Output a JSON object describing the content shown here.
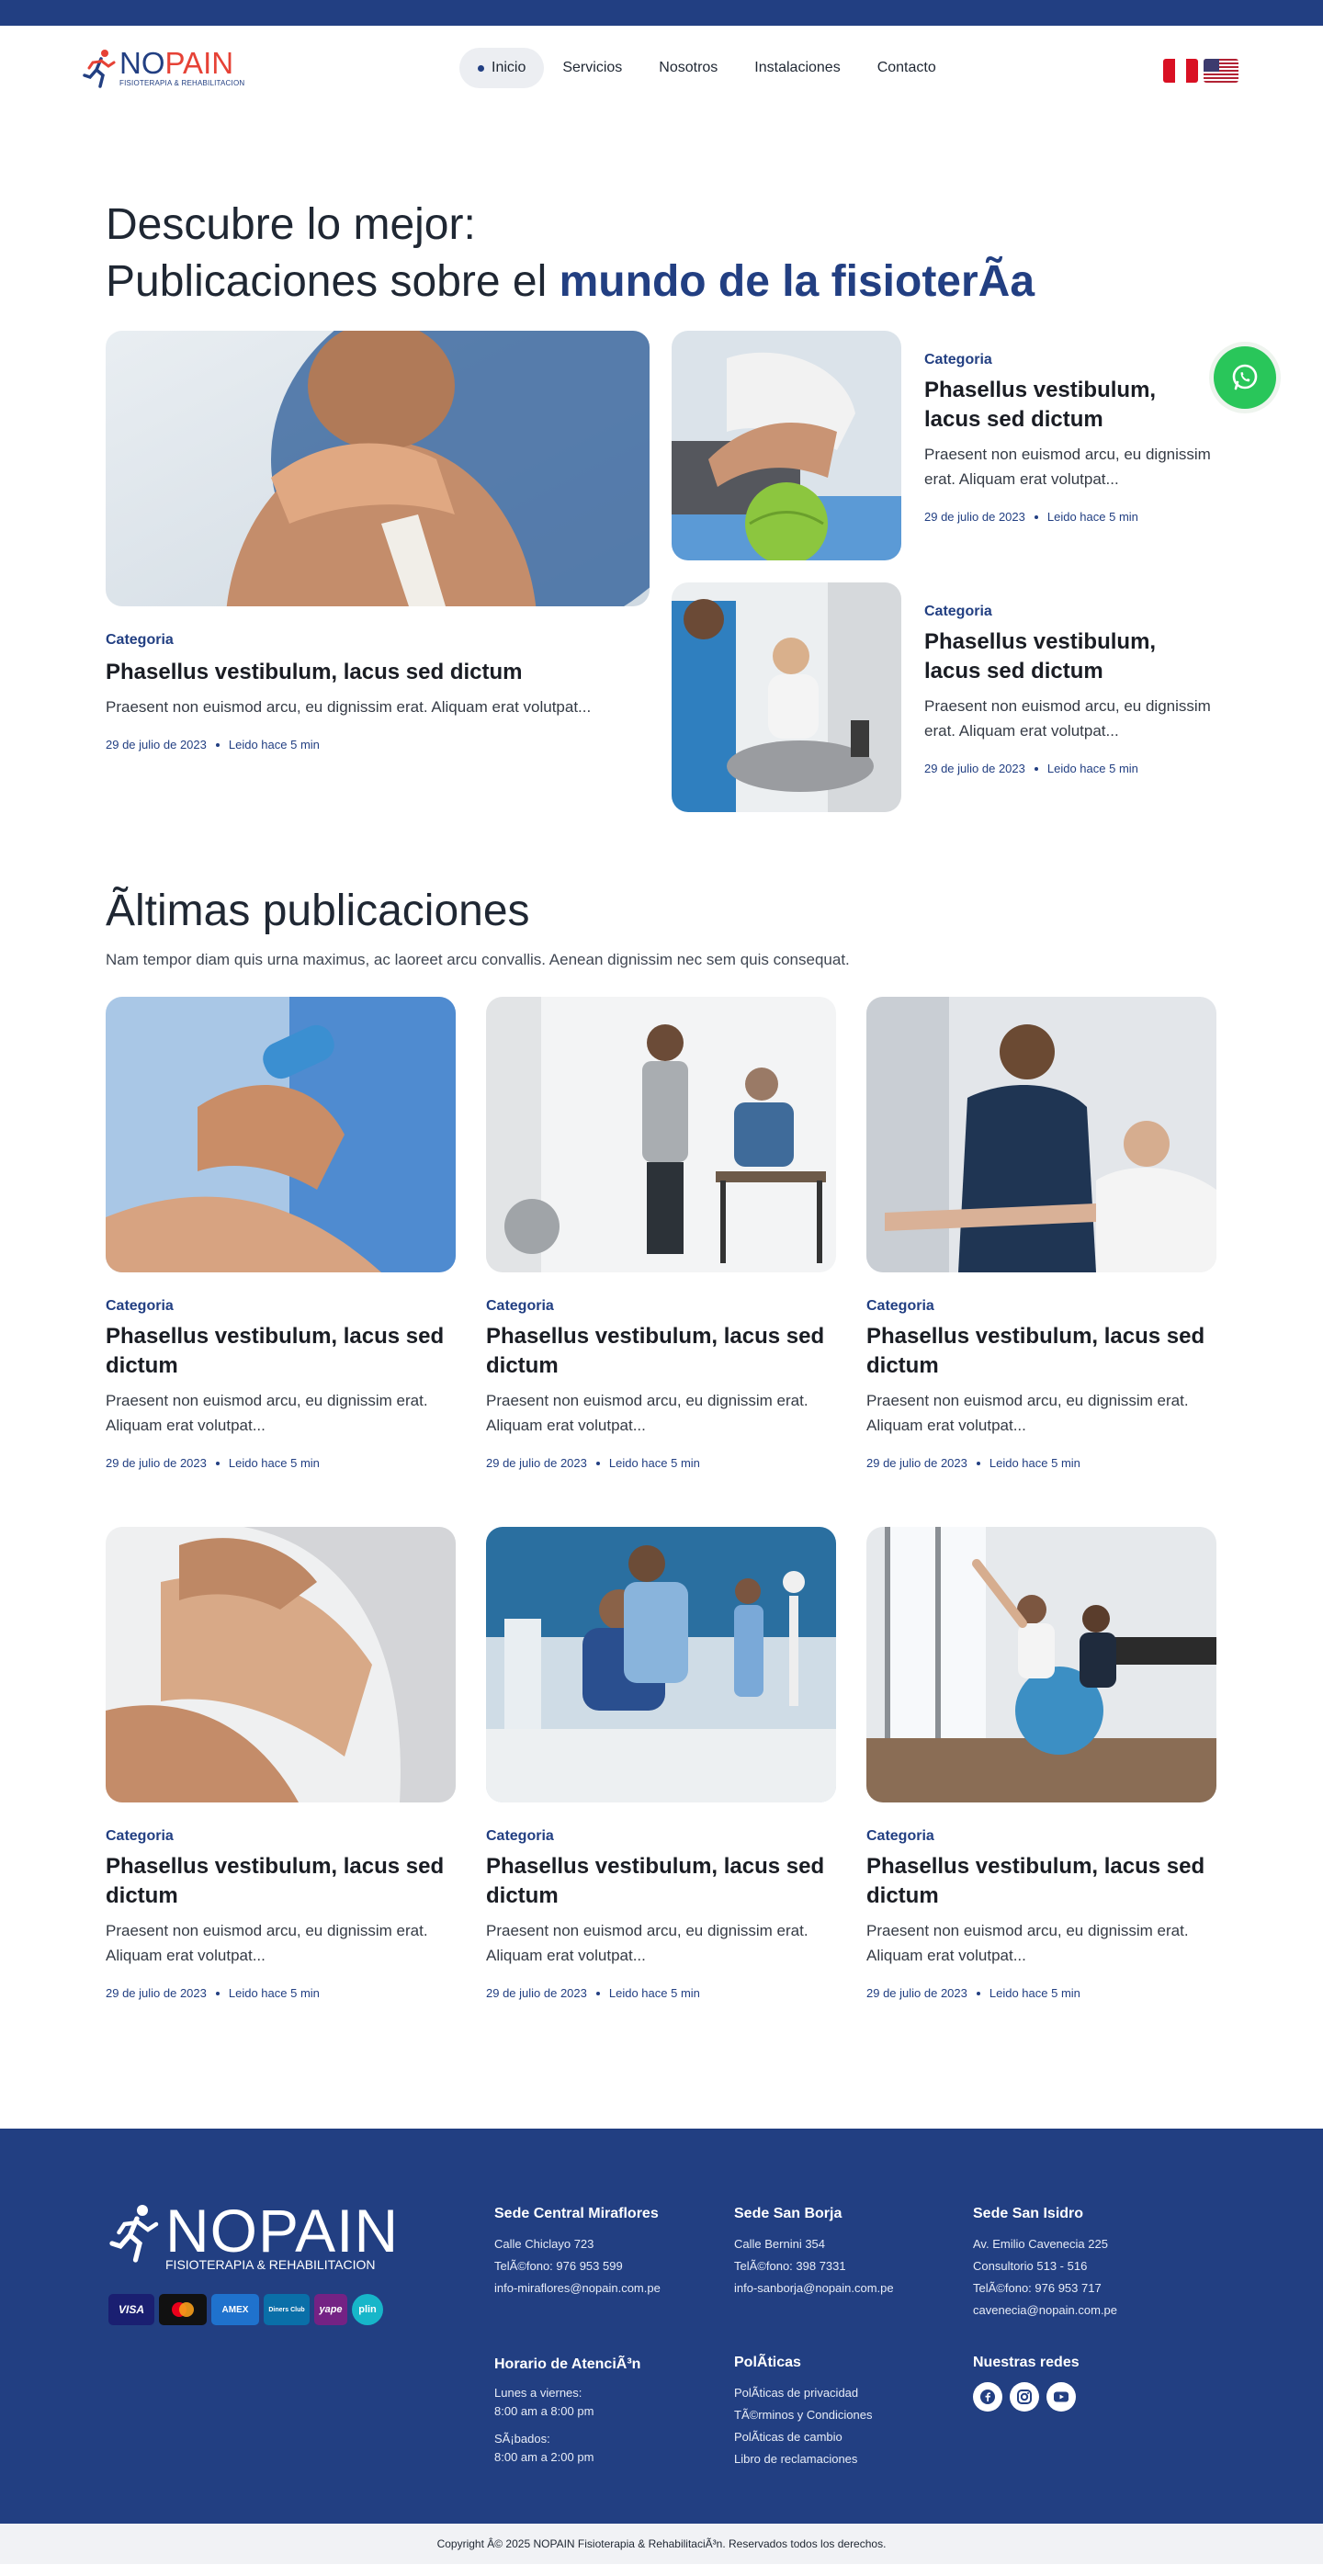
{
  "brand": {
    "name_part1": "NO",
    "name_part2": "PAIN",
    "tagline": "FISIOTERAPIA & REHABILITACION",
    "footer_name": "NOPAIN",
    "footer_tagline": "FISIOTERAPIA & REHABILITACION",
    "primary_color": "#223f82",
    "accent_color": "#e64236"
  },
  "nav": {
    "items": [
      {
        "label": "Inicio",
        "active": true
      },
      {
        "label": "Servicios"
      },
      {
        "label": "Nosotros"
      },
      {
        "label": "Instalaciones"
      },
      {
        "label": "Contacto"
      }
    ],
    "languages": [
      "peru-flag-icon",
      "usa-flag-icon"
    ]
  },
  "hero": {
    "line1": "Descubre lo mejor:",
    "line2_prefix": "Publicaciones sobre el ",
    "line2_accent": "mundo de la fisioterÃ­a"
  },
  "featured": {
    "main": {
      "category": "Categoria",
      "title": "Phasellus vestibulum, lacus sed dictum",
      "excerpt": "Praesent non euismod arcu, eu dignissim erat. Aliquam erat volutpat...",
      "date": "29 de julio de 2023",
      "read": "Leido hace 5 min"
    },
    "side": [
      {
        "category": "Categoria",
        "title": "Phasellus vestibulum, lacus sed dictum",
        "excerpt": "Praesent non euismod arcu, eu dignissim erat. Aliquam erat volutpat...",
        "date": "29 de julio de 2023",
        "read": "Leido hace 5 min"
      },
      {
        "category": "Categoria",
        "title": "Phasellus vestibulum, lacus sed dictum",
        "excerpt": "Praesent non euismod arcu, eu dignissim erat. Aliquam erat volutpat...",
        "date": "29 de julio de 2023",
        "read": "Leido hace 5 min"
      }
    ]
  },
  "latest": {
    "title": "Ãltimas publicaciones",
    "subtitle": "Nam tempor diam quis urna maximus, ac laoreet arcu convallis. Aenean dignissim nec sem quis consequat.",
    "posts": [
      {
        "category": "Categoria",
        "title": "Phasellus vestibulum, lacus sed dictum",
        "excerpt": "Praesent non euismod arcu, eu dignissim erat. Aliquam erat volutpat...",
        "date": "29 de julio de 2023",
        "read": "Leido hace 5 min"
      },
      {
        "category": "Categoria",
        "title": "Phasellus vestibulum, lacus sed dictum",
        "excerpt": "Praesent non euismod arcu, eu dignissim erat. Aliquam erat volutpat...",
        "date": "29 de julio de 2023",
        "read": "Leido hace 5 min"
      },
      {
        "category": "Categoria",
        "title": "Phasellus vestibulum, lacus sed dictum",
        "excerpt": "Praesent non euismod arcu, eu dignissim erat. Aliquam erat volutpat...",
        "date": "29 de julio de 2023",
        "read": "Leido hace 5 min"
      },
      {
        "category": "Categoria",
        "title": "Phasellus vestibulum, lacus sed dictum",
        "excerpt": "Praesent non euismod arcu, eu dignissim erat. Aliquam erat volutpat...",
        "date": "29 de julio de 2023",
        "read": "Leido hace 5 min"
      },
      {
        "category": "Categoria",
        "title": "Phasellus vestibulum, lacus sed dictum",
        "excerpt": "Praesent non euismod arcu, eu dignissim erat. Aliquam erat volutpat...",
        "date": "29 de julio de 2023",
        "read": "Leido hace 5 min"
      },
      {
        "category": "Categoria",
        "title": "Phasellus vestibulum, lacus sed dictum",
        "excerpt": "Praesent non euismod arcu, eu dignissim erat. Aliquam erat volutpat...",
        "date": "29 de julio de 2023",
        "read": "Leido hace 5 min"
      }
    ]
  },
  "footer": {
    "payments": [
      "VISA",
      "mastercard",
      "AMEX",
      "Diners Club",
      "yape",
      "plin"
    ],
    "miraflores": {
      "title": "Sede Central Miraflores",
      "lines": [
        "Calle Chiclayo 723",
        "TelÃ©fono: 976 953 599",
        "info-miraflores@nopain.com.pe"
      ]
    },
    "sanborja": {
      "title": "Sede San Borja",
      "lines": [
        "Calle Bernini 354",
        "TelÃ©fono: 398 7331",
        "info-sanborja@nopain.com.pe"
      ]
    },
    "sanisidro": {
      "title": "Sede San Isidro",
      "lines": [
        "Av. Emilio Cavenecia 225",
        "Consultorio 513 - 516",
        "TelÃ©fono: 976 953 717",
        "cavenecia@nopain.com.pe"
      ]
    },
    "hours": {
      "title": "Horario de AtenciÃ³n",
      "weekdays_label": "Lunes a viernes:",
      "weekdays_hours": "8:00 am a 8:00 pm",
      "saturday_label": "SÃ¡bados:",
      "saturday_hours": "8:00 am a 2:00 pm"
    },
    "policies": {
      "title": "PolÃ­ticas",
      "links": [
        "PolÃ­ticas de privacidad",
        "TÃ©rminos y Condiciones",
        "PolÃ­ticas de cambio",
        "Libro de reclamaciones"
      ]
    },
    "social": {
      "title": "Nuestras redes",
      "icons": [
        "facebook-icon",
        "instagram-icon",
        "youtube-icon"
      ]
    },
    "copyright": "Copyright Â© 2025 NOPAIN Fisioterapia & RehabilitaciÃ³n. Reservados todos los derechos."
  }
}
